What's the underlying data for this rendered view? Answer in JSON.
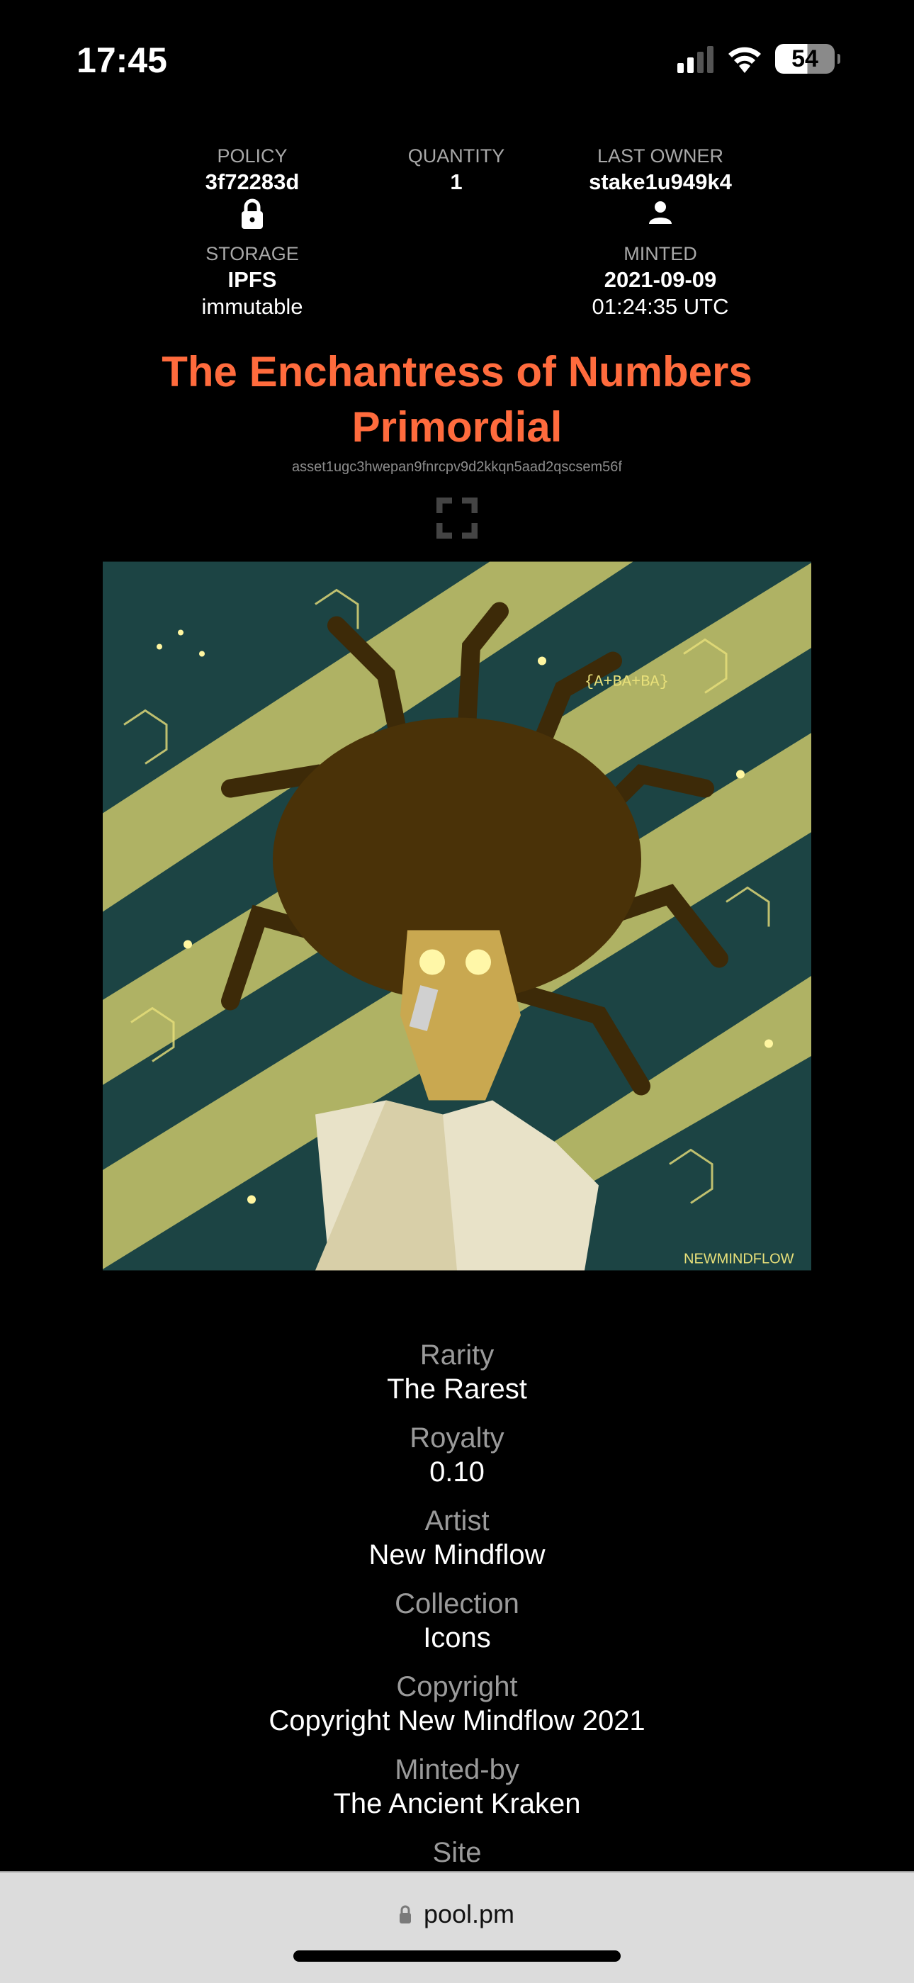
{
  "status_bar": {
    "time": "17:45",
    "battery": "54",
    "icons": [
      "signal-icon",
      "wifi-icon",
      "battery-icon"
    ]
  },
  "header": {
    "policy": {
      "label": "POLICY",
      "value": "3f72283d",
      "icon": "lock-icon"
    },
    "quantity": {
      "label": "QUANTITY",
      "value": "1"
    },
    "last_owner": {
      "label": "LAST OWNER",
      "value": "stake1u949k4",
      "icon": "user-icon"
    },
    "storage": {
      "label": "STORAGE",
      "value": "IPFS",
      "sub": "immutable"
    },
    "minted": {
      "label": "MINTED",
      "date": "2021-09-09",
      "time": "01:24:35 UTC"
    }
  },
  "asset": {
    "title_line1": "The Enchantress of Numbers",
    "title_line2": "Primordial",
    "id": "asset1ugc3hwepan9fnrcpv9d2kkqn5aad2qscsem56f",
    "title_color": "#ff6b3d",
    "expand_icon": "fullscreen-icon",
    "artwork_text": [
      "{A+BA+BA}",
      "NEWMINDFLOW"
    ]
  },
  "fields": [
    {
      "label": "Rarity",
      "value": "The Rarest"
    },
    {
      "label": "Royalty",
      "value": "0.10"
    },
    {
      "label": "Artist",
      "value": "New Mindflow"
    },
    {
      "label": "Collection",
      "value": "Icons"
    },
    {
      "label": "Copyright",
      "value": "Copyright New Mindflow 2021"
    },
    {
      "label": "Minted-by",
      "value": "The Ancient Kraken"
    },
    {
      "label": "Site",
      "value": ""
    }
  ],
  "browser": {
    "url": "pool.pm"
  }
}
